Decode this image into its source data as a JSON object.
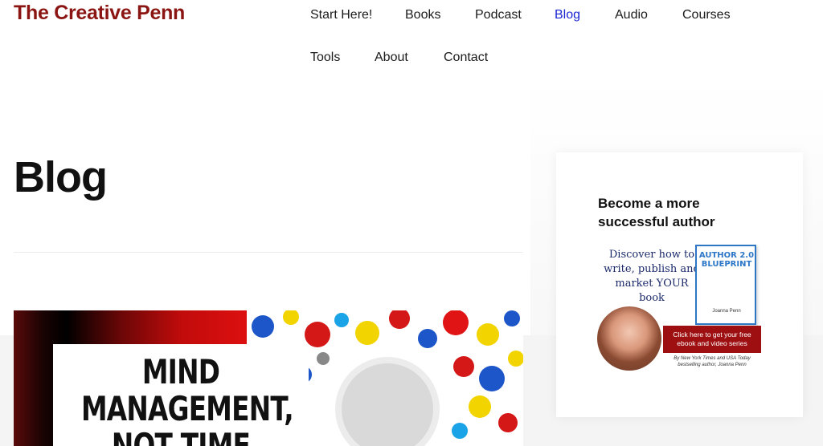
{
  "site": {
    "title": "The Creative Penn"
  },
  "nav": {
    "items": [
      {
        "label": "Start Here!"
      },
      {
        "label": "Books"
      },
      {
        "label": "Podcast"
      },
      {
        "label": "Blog"
      },
      {
        "label": "Audio"
      },
      {
        "label": "Courses"
      },
      {
        "label": "Tools"
      },
      {
        "label": "About"
      },
      {
        "label": "Contact"
      }
    ],
    "active": "Blog"
  },
  "page": {
    "title": "Blog"
  },
  "featured_post": {
    "image_lines": [
      "MIND",
      "MANAGEMENT,",
      "NOT TIME"
    ]
  },
  "sidebar": {
    "widget_title": "Become a more successful author",
    "ad": {
      "headline": "Discover how to write, publish and market YOUR book",
      "book_title": "AUTHOR 2.0 BLUEPRINT",
      "book_author": "Joanna Penn",
      "cta": "Click here to get your free ebook and video series",
      "byline": "By New York Times and USA Today bestselling author, Joanna Penn"
    }
  },
  "colors": {
    "brand": "#8b1512",
    "active_link": "#1a25d4",
    "cta_bg": "#9e0f12",
    "book_blue": "#2e77c7"
  }
}
